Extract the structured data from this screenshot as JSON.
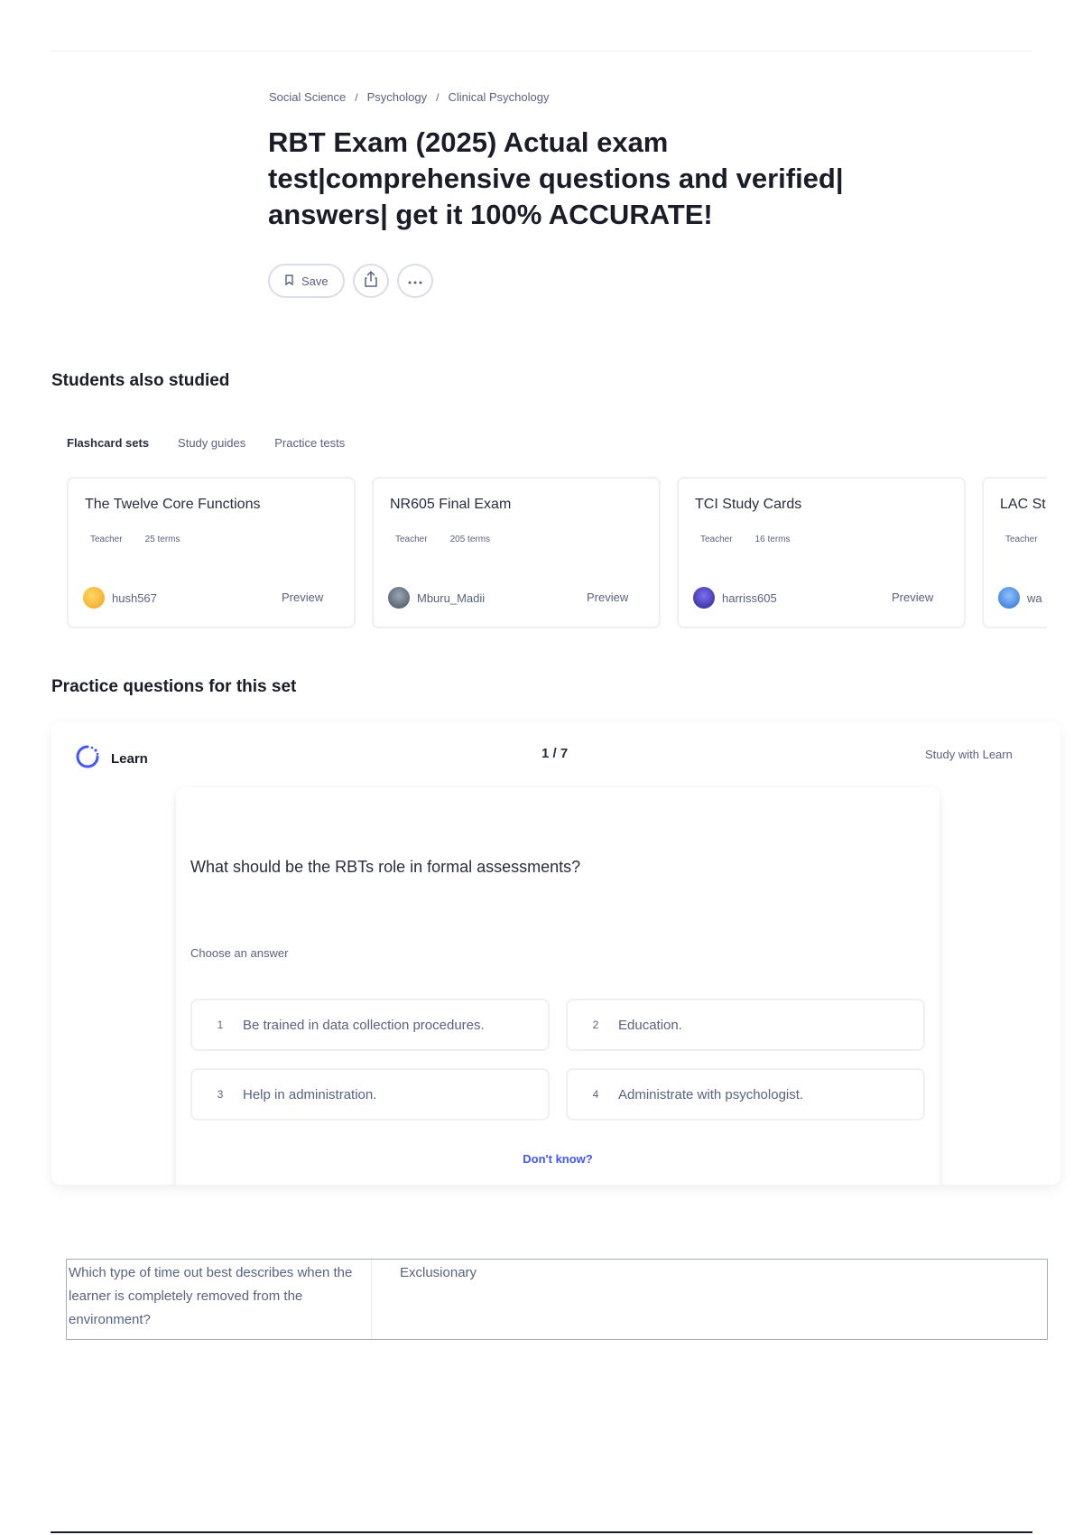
{
  "breadcrumb": [
    "Social Science",
    "Psychology",
    "Clinical Psychology"
  ],
  "title": "RBT Exam (2025) Actual exam test|comprehensive questions and verified| answers| get it 100% ACCURATE!",
  "actions": {
    "save_label": "Save"
  },
  "students_also_studied": {
    "heading": "Students also studied",
    "tabs": [
      "Flashcard sets",
      "Study guides",
      "Practice tests"
    ],
    "cards": [
      {
        "title": "The Twelve Core Functions",
        "author_type": "Teacher",
        "terms": "25 terms",
        "user": "hush567",
        "preview": "Preview",
        "avatar_color": "#f5b52b"
      },
      {
        "title": "NR605 Final Exam",
        "author_type": "Teacher",
        "terms": "205 terms",
        "user": "Mburu_Madii",
        "preview": "Preview",
        "avatar_color": "#5d6b7e"
      },
      {
        "title": "TCI Study Cards",
        "author_type": "Teacher",
        "terms": "16 terms",
        "user": "harriss605",
        "preview": "Preview",
        "avatar_color": "#4b3fbf"
      },
      {
        "title": "LAC St",
        "author_type": "Teacher",
        "terms": "",
        "user": "wa",
        "preview": "",
        "avatar_color": "#3f83e0"
      }
    ]
  },
  "practice": {
    "heading": "Practice questions for this set",
    "mode_label": "Learn",
    "progress": "1 / 7",
    "study_link": "Study with Learn",
    "question": "What should be the RBTs role in formal assessments?",
    "hint": "Choose an answer",
    "answers": [
      {
        "num": "1",
        "text": "Be trained in data collection procedures."
      },
      {
        "num": "2",
        "text": "Education."
      },
      {
        "num": "3",
        "text": "Help in administration."
      },
      {
        "num": "4",
        "text": "Administrate with psychologist."
      }
    ],
    "dont_know": "Don't know?"
  },
  "qa_table": {
    "question": "Which type of time out best describes when the learner is completely removed from the environment?",
    "answer": "Exclusionary"
  },
  "colors": {
    "accent": "#4255ff",
    "text": "#282e3e",
    "muted": "#586380"
  }
}
